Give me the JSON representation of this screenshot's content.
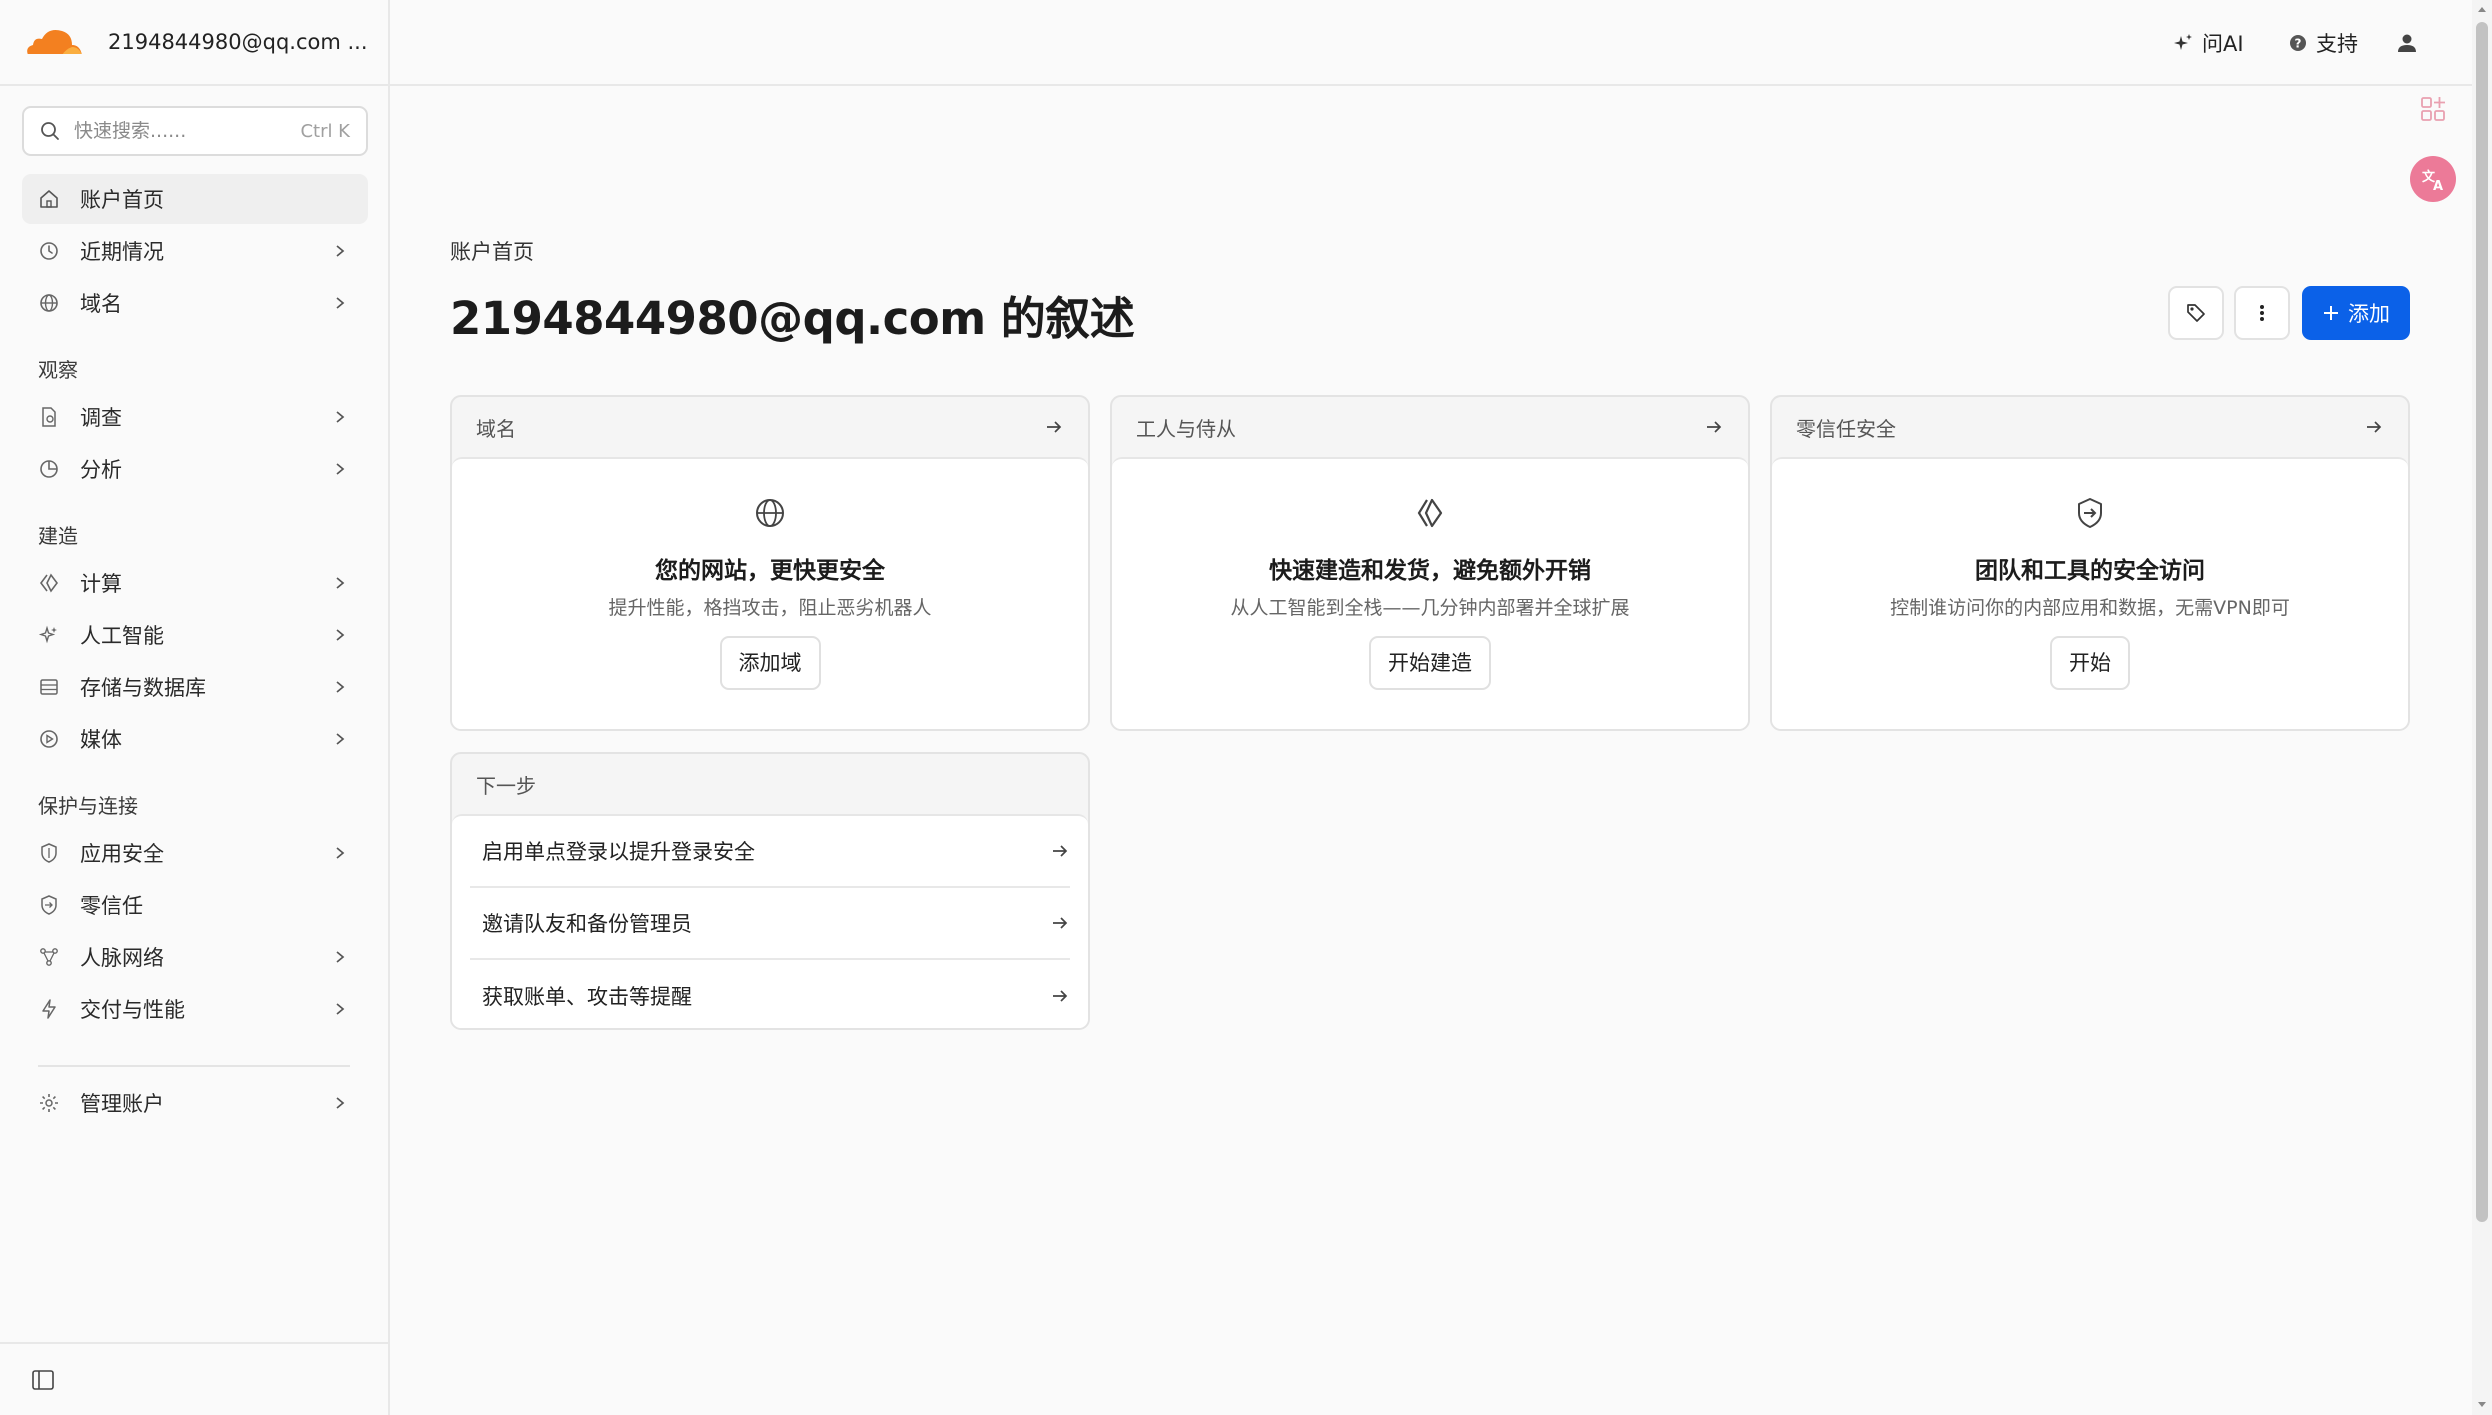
{
  "account": {
    "label": "2194844980@qq.com ..."
  },
  "search": {
    "placeholder": "快速搜索......",
    "shortcut": "Ctrl K"
  },
  "sidebar": {
    "items": [
      {
        "label": "账户首页"
      },
      {
        "label": "近期情况"
      },
      {
        "label": "域名"
      }
    ],
    "observe": {
      "title": "观察",
      "items": [
        {
          "label": "调查"
        },
        {
          "label": "分析"
        }
      ]
    },
    "build": {
      "title": "建造",
      "items": [
        {
          "label": "计算"
        },
        {
          "label": "人工智能"
        },
        {
          "label": "存储与数据库"
        },
        {
          "label": "媒体"
        }
      ]
    },
    "protect": {
      "title": "保护与连接",
      "items": [
        {
          "label": "应用安全"
        },
        {
          "label": "零信任"
        },
        {
          "label": "人脉网络"
        },
        {
          "label": "交付与性能"
        }
      ]
    },
    "manage": {
      "label": "管理账户"
    }
  },
  "topbar": {
    "ask_ai": "问AI",
    "support": "支持"
  },
  "main": {
    "breadcrumb": "账户首页",
    "title": "2194844980@qq.com 的叙述",
    "add_label": "添加",
    "cards": [
      {
        "header": "域名",
        "title": "您的网站，更快更安全",
        "desc": "提升性能，格挡攻击，阻止恶劣机器人",
        "button": "添加域"
      },
      {
        "header": "工人与侍从",
        "title": "快速建造和发货，避免额外开销",
        "desc": "从人工智能到全栈——几分钟内部署并全球扩展",
        "button": "开始建造"
      },
      {
        "header": "零信任安全",
        "title": "团队和工具的安全访问",
        "desc": "控制谁访问你的内部应用和数据，无需VPN即可",
        "button": "开始"
      }
    ],
    "next_steps": {
      "header": "下一步",
      "items": [
        {
          "label": "启用单点登录以提升登录安全"
        },
        {
          "label": "邀请队友和备份管理员"
        },
        {
          "label": "获取账单、攻击等提醒"
        }
      ]
    }
  },
  "colors": {
    "primary": "#0b61e8",
    "brand_orange": "#f38020",
    "brand_orange_light": "#faae40"
  }
}
